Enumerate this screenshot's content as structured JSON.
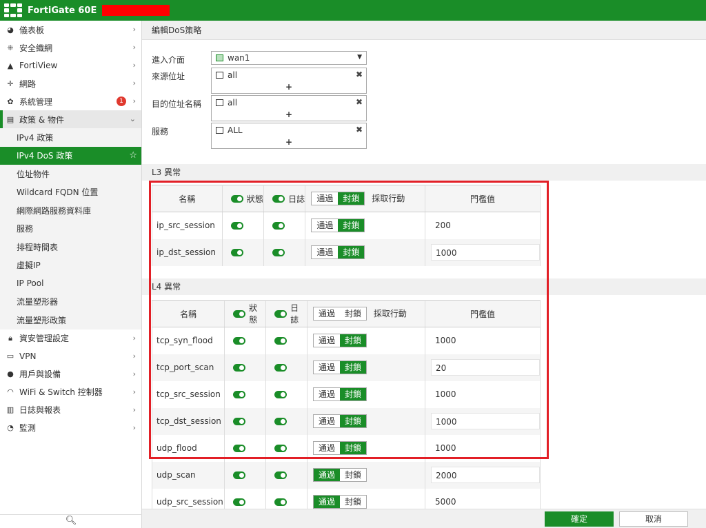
{
  "header": {
    "product": "FortiGate 60E"
  },
  "sidebar": {
    "items": [
      {
        "label": "儀表板",
        "icon": "dashboard-icon"
      },
      {
        "label": "安全織網",
        "icon": "fabric-icon"
      },
      {
        "label": "FortiView",
        "icon": "chart-icon"
      },
      {
        "label": "網路",
        "icon": "network-icon"
      },
      {
        "label": "系統管理",
        "icon": "gear-icon",
        "badge": "1"
      },
      {
        "label": "政策 & 物件",
        "icon": "policy-icon"
      }
    ],
    "subitems": [
      "IPv4 政策",
      "IPv4 DoS 政策",
      "位址物件",
      "Wildcard FQDN 位置",
      "網際網路服務資料庫",
      "服務",
      "排程時間表",
      "虛擬IP",
      "IP Pool",
      "流量塑形器",
      "流量塑形政策"
    ],
    "bottom_items": [
      {
        "label": "資安管理設定",
        "icon": "lock-icon"
      },
      {
        "label": "VPN",
        "icon": "laptop-icon"
      },
      {
        "label": "用戶與設備",
        "icon": "user-icon"
      },
      {
        "label": "WiFi & Switch 控制器",
        "icon": "wifi-icon"
      },
      {
        "label": "日誌與報表",
        "icon": "log-icon"
      },
      {
        "label": "監測",
        "icon": "pie-icon"
      }
    ]
  },
  "page": {
    "title": "編輯DoS策略"
  },
  "form": {
    "interface_label": "進入介面",
    "interface_value": "wan1",
    "src_label": "來源位址",
    "src_value": "all",
    "dst_label": "目的位址名稱",
    "dst_value": "all",
    "service_label": "服務",
    "service_value": "ALL",
    "plus": "+",
    "remove": "✖"
  },
  "l3": {
    "title": "L3 異常"
  },
  "l4": {
    "title": "L4 異常"
  },
  "columns": {
    "name": "名稱",
    "status": "狀態",
    "log": "日誌",
    "pass": "通過",
    "block": "封鎖",
    "action": "採取行動",
    "threshold": "門檻值"
  },
  "l3_rows": [
    {
      "name": "ip_src_session",
      "threshold": "200",
      "action": "block"
    },
    {
      "name": "ip_dst_session",
      "threshold": "1000",
      "action": "block"
    }
  ],
  "l4_rows": [
    {
      "name": "tcp_syn_flood",
      "threshold": "1000",
      "action": "block"
    },
    {
      "name": "tcp_port_scan",
      "threshold": "20",
      "action": "block"
    },
    {
      "name": "tcp_src_session",
      "threshold": "1000",
      "action": "block"
    },
    {
      "name": "tcp_dst_session",
      "threshold": "1000",
      "action": "block"
    },
    {
      "name": "udp_flood",
      "threshold": "1000",
      "action": "block"
    },
    {
      "name": "udp_scan",
      "threshold": "2000",
      "action": "pass"
    },
    {
      "name": "udp_src_session",
      "threshold": "5000",
      "action": "pass"
    }
  ],
  "footer": {
    "ok": "確定",
    "cancel": "取消"
  },
  "colors": {
    "brand": "#1a8d28",
    "highlight": "#e21f26"
  }
}
